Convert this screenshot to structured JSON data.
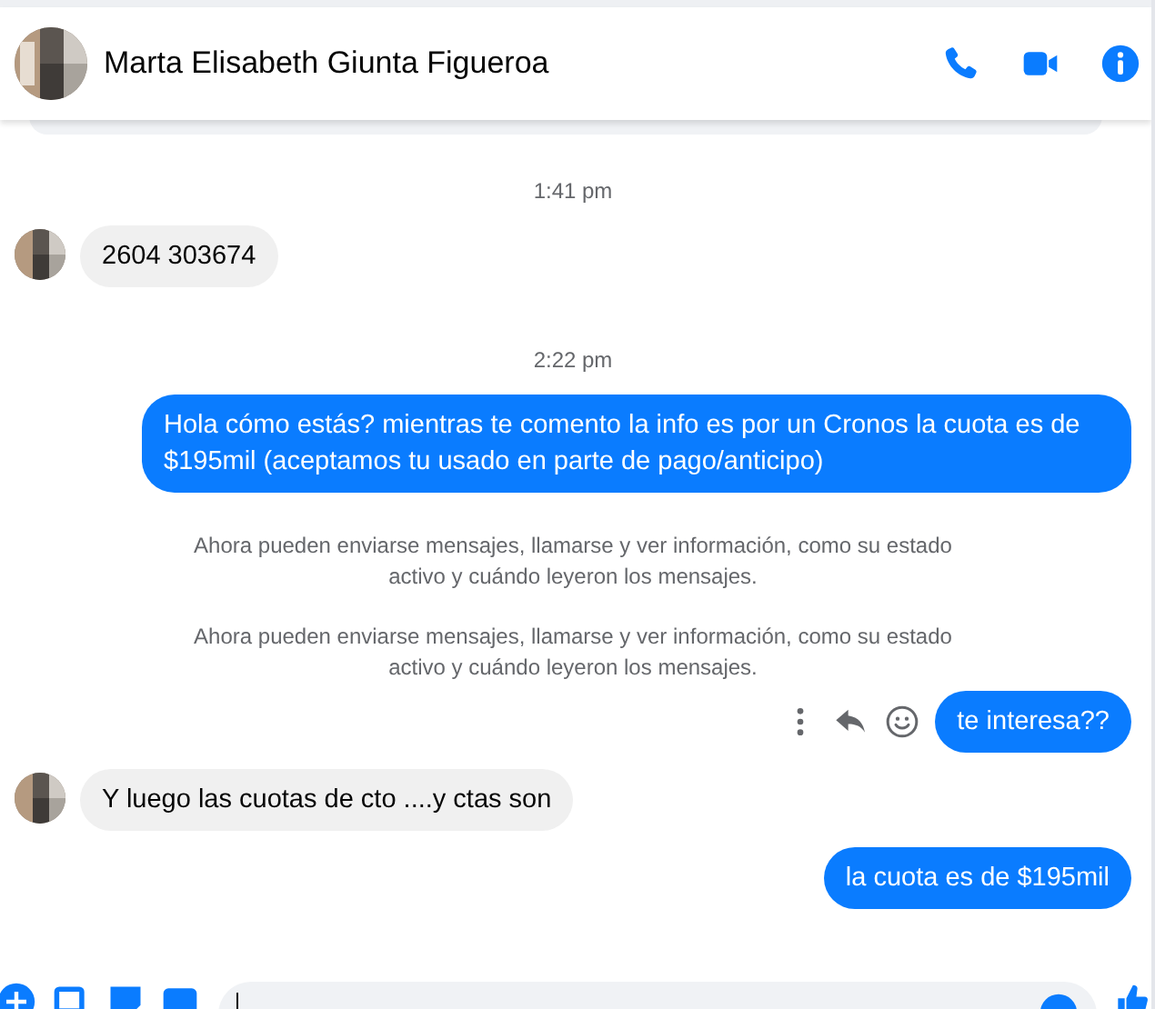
{
  "header": {
    "name": "Marta Elisabeth Giunta Figueroa"
  },
  "messages": [
    {
      "kind": "cut"
    },
    {
      "kind": "time",
      "text": "1:41 pm"
    },
    {
      "kind": "incoming",
      "text": "2604 303674"
    },
    {
      "kind": "time",
      "text": "2:22 pm"
    },
    {
      "kind": "outgoing",
      "text": "Hola cómo estás? mientras te comento la info es por un Cronos la cuota es de $195mil (aceptamos tu usado en parte de pago/anticipo)",
      "actions": false
    },
    {
      "kind": "notice",
      "text": "Ahora pueden enviarse mensajes, llamarse y ver información, como su estado activo y cuándo leyeron los mensajes."
    },
    {
      "kind": "notice",
      "text": "Ahora pueden enviarse mensajes, llamarse y ver información, como su estado activo y cuándo leyeron los mensajes."
    },
    {
      "kind": "outgoing",
      "text": "te interesa??",
      "actions": true
    },
    {
      "kind": "incoming",
      "text": "Y luego las cuotas de cto ....y ctas son"
    },
    {
      "kind": "outgoing",
      "text": "la cuota es de $195mil",
      "actions": false
    }
  ]
}
